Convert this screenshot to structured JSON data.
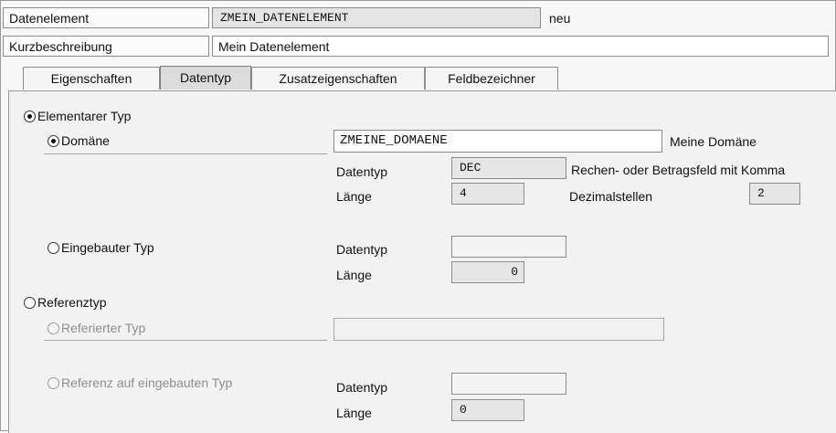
{
  "header": {
    "datenelement_label": "Datenelement",
    "datenelement_value": "ZMEIN_DATENELEMENT",
    "status": "neu",
    "kurzbeschreibung_label": "Kurzbeschreibung",
    "kurzbeschreibung_value": "Mein Datenelement"
  },
  "tabs": [
    {
      "label": "Eigenschaften"
    },
    {
      "label": "Datentyp"
    },
    {
      "label": "Zusatzeigenschaften"
    },
    {
      "label": "Feldbezeichner"
    }
  ],
  "content": {
    "elementarer_typ": "Elementarer Typ",
    "domaene": "Domäne",
    "domaene_value": "ZMEINE_DOMAENE",
    "domaene_desc": "Meine Domäne",
    "dom_datentyp_label": "Datentyp",
    "dom_datentyp_value": "DEC",
    "dom_datentyp_desc": "Rechen- oder Betragsfeld mit Komma",
    "dom_laenge_label": "Länge",
    "dom_laenge_value": "4",
    "dezimalstellen_label": "Dezimalstellen",
    "dezimalstellen_value": "2",
    "eingebauter_typ": "Eingebauter Typ",
    "eb_datentyp_label": "Datentyp",
    "eb_datentyp_value": "",
    "eb_laenge_label": "Länge",
    "eb_laenge_value": "0",
    "referenztyp": "Referenztyp",
    "referierter_typ": "Referierter Typ",
    "referierter_typ_value": "",
    "referenz_eingebaut": "Referenz auf eingebauten Typ",
    "ref_datentyp_label": "Datentyp",
    "ref_datentyp_value": "",
    "ref_laenge_label": "Länge",
    "ref_laenge_value": "0"
  }
}
